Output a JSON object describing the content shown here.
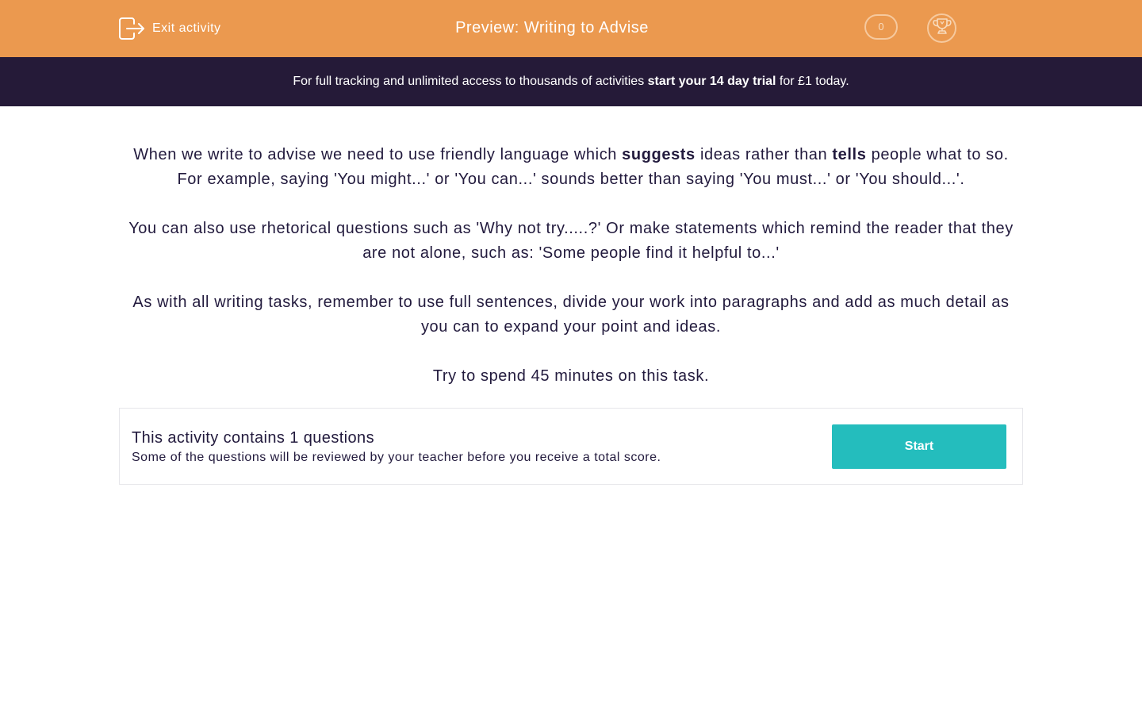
{
  "header": {
    "exit_label": "Exit activity",
    "title": "Preview: Writing to Advise",
    "score": "0",
    "exit_icon": "exit-icon",
    "trophy_icon": "trophy-icon"
  },
  "banner": {
    "text_before": "For full tracking and unlimited access to thousands of activities ",
    "cta": "start your 14 day trial",
    "text_after": " for £1 today."
  },
  "content": {
    "p1": {
      "part1": "When we write to advise we need to use friendly language which ",
      "bold1": "suggests",
      "part2": " ideas rather than ",
      "bold2": "tells",
      "part3": " people what to so. For example, saying 'You might...' or 'You can...' sounds better than saying 'You must...' or 'You should...'."
    },
    "p2": "You can also use rhetorical questions such as 'Why not try.....?' Or make statements which remind the reader that they are not alone, such as: 'Some people find it helpful to...'",
    "p3": "As with all writing tasks, remember to use full sentences, divide your work into paragraphs and add as much detail as you can to expand your point and ideas.",
    "p4": "Try to spend 45 minutes on this task."
  },
  "card": {
    "title": "This activity contains 1 questions",
    "subtitle": "Some of the questions will be reviewed by your teacher before you receive a total score.",
    "start_label": "Start"
  },
  "colors": {
    "header_bg": "#eb994f",
    "banner_bg": "#251a38",
    "text": "#221a3d",
    "start_button": "#24bdbd"
  }
}
